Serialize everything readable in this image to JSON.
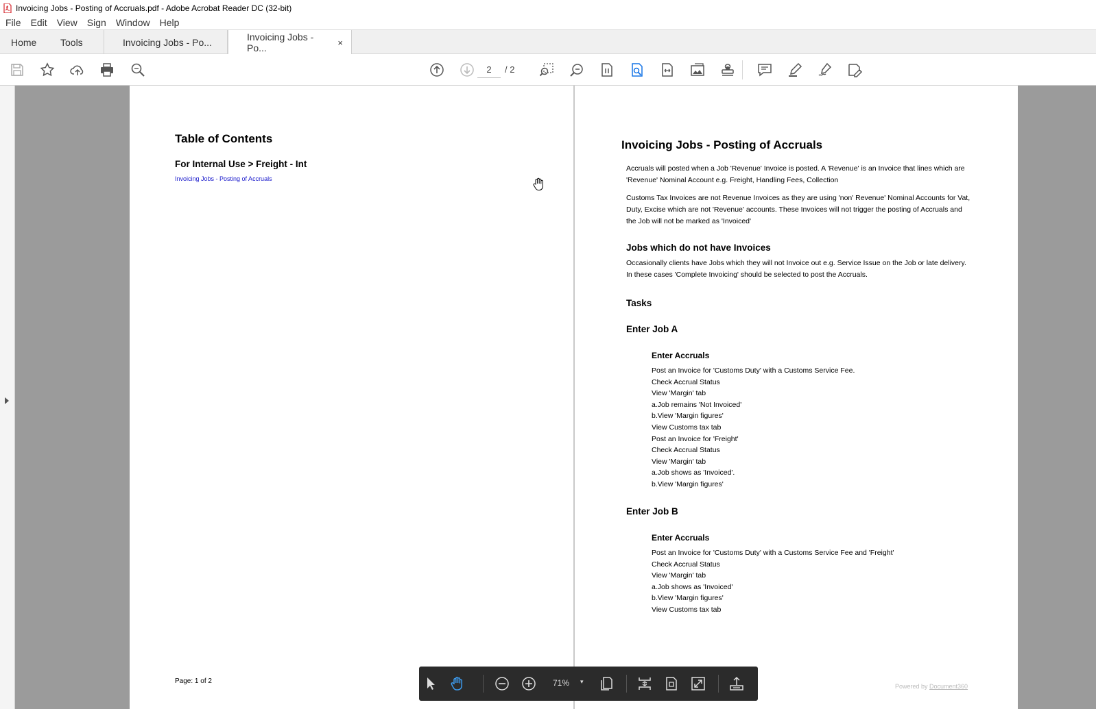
{
  "window": {
    "title": "Invoicing Jobs - Posting of Accruals.pdf - Adobe Acrobat Reader DC (32-bit)"
  },
  "menu": [
    "File",
    "Edit",
    "View",
    "Sign",
    "Window",
    "Help"
  ],
  "tabs": {
    "home": "Home",
    "tools": "Tools",
    "doc1": "Invoicing Jobs - Po...",
    "doc2": "Invoicing Jobs - Po...",
    "close": "×"
  },
  "toolbar": {
    "page_current": "2",
    "page_total": "/ 2"
  },
  "left_page": {
    "heading": "Table of Contents",
    "subheading": "For Internal Use > Freight - Int",
    "toc_link": "Invoicing Jobs - Posting of Accruals",
    "footer": "Page: 1 of 2"
  },
  "right_page": {
    "title": "Invoicing Jobs - Posting of Accruals",
    "para1": "Accruals will posted when a Job 'Revenue' Invoice is posted. A 'Revenue' is an Invoice that lines which are 'Revenue' Nominal Account e.g. Freight, Handling Fees, Collection",
    "para2": "Customs Tax Invoices are not Revenue Invoices as they are using 'non' Revenue' Nominal Accounts for Vat, Duty, Excise which are not 'Revenue' accounts. These Invoices will not trigger the posting of Accruals and the Job will not be marked as 'Invoiced'",
    "h_no_invoices": "Jobs which do not have Invoices",
    "para3": "Occasionally clients have Jobs which they will not Invoice out e.g. Service Issue on the Job or late delivery. In these cases 'Complete Invoicing' should be selected to post the Accruals.",
    "h_tasks": "Tasks",
    "h_job_a": "Enter Job A",
    "h_accruals_a": "Enter Accruals",
    "list_a": [
      "Post an Invoice for 'Customs Duty' with a Customs Service Fee.",
      "Check Accrual Status",
      "View 'Margin' tab",
      "a.Job remains 'Not Invoiced'",
      "b.View 'Margin figures'",
      "View Customs tax tab",
      "Post an Invoice for 'Freight'",
      "Check Accrual Status",
      "View 'Margin' tab",
      "a.Job shows as 'Invoiced'.",
      "b.View 'Margin figures'"
    ],
    "h_job_b": "Enter Job B",
    "h_accruals_b": "Enter Accruals",
    "list_b": [
      "Post an Invoice for 'Customs Duty' with a Customs Service Fee and 'Freight'",
      "Check Accrual Status",
      "View 'Margin' tab",
      "a.Job shows as 'Invoiced'",
      "b.View 'Margin figures'",
      "View Customs tax tab"
    ],
    "powered_prefix": "Powered by ",
    "powered_link": "Document360"
  },
  "floating_toolbar": {
    "zoom": "71%",
    "caret": "▾"
  },
  "icons": [
    "save-icon",
    "bookmark-star-icon",
    "upload-cloud-icon",
    "print-icon",
    "find-icon",
    "page-up-icon",
    "page-down-icon",
    "marquee-zoom-icon",
    "zoom-in-icon",
    "page-view-icon",
    "search-doc-icon",
    "fit-width-icon",
    "image-icon",
    "stamp-icon",
    "comment-icon",
    "highlight-icon",
    "sign-icon",
    "edit-icon",
    "select-arrow-icon",
    "hand-tool-icon",
    "zoom-out-icon",
    "zoom-plus-icon",
    "page-display-icon",
    "scroll-mode-icon",
    "fit-page-icon",
    "fullscreen-icon",
    "share-icon"
  ]
}
